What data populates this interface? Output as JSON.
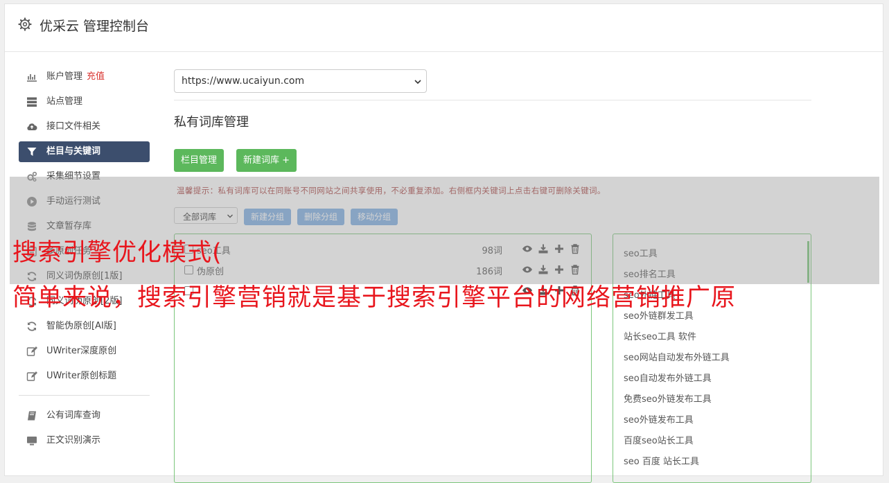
{
  "header": {
    "title": "优采云 管理控制台",
    "icon": "gear-icon"
  },
  "sidebar": {
    "items": [
      {
        "label": "账户管理",
        "badge": "充值",
        "icon": "bar-chart-icon"
      },
      {
        "label": "站点管理",
        "icon": "server-icon"
      },
      {
        "label": "接口文件相关",
        "icon": "cloud-upload-icon"
      },
      {
        "label": "栏目与关键词",
        "icon": "filter-icon",
        "active": true
      },
      {
        "label": "采集细节设置",
        "icon": "gears-icon"
      },
      {
        "label": "手动运行测试",
        "icon": "play-circle-icon"
      },
      {
        "label": "文章暂存库",
        "icon": "database-icon"
      },
      {
        "label": "多原创任务",
        "icon": "tasks-icon"
      },
      {
        "label": "同义词伪原创[1版]",
        "icon": "refresh-icon"
      },
      {
        "label": "同义词伪原创[2版]",
        "icon": "refresh-icon"
      },
      {
        "label": "智能伪原创[AI版]",
        "icon": "refresh-icon"
      },
      {
        "label": "UWriter深度原创",
        "icon": "edit-icon"
      },
      {
        "label": "UWriter原创标题",
        "icon": "edit-icon"
      }
    ],
    "items2": [
      {
        "label": "公有词库查询",
        "icon": "book-icon"
      },
      {
        "label": "正文识别演示",
        "icon": "monitor-icon"
      }
    ]
  },
  "main": {
    "site_select": "https://www.ucaiyun.com",
    "section_title": "私有词库管理",
    "btn_columns": "栏目管理",
    "btn_new_lib": "新建词库 +",
    "tip": "温馨提示：私有词库可以在同账号不同网站之间共享使用，不必重复添加。右侧框内关键词上点击右键可删除关键词。",
    "lib_filter": "全部词库",
    "btn_new_group": "新建分组",
    "btn_delete_group": "删除分组",
    "btn_move_group": "移动分组",
    "libraries": [
      {
        "name": "seo工具",
        "count": "98词"
      },
      {
        "name": "伪原创",
        "count": "186词"
      },
      {
        "name": "",
        "count": ""
      }
    ],
    "keywords": [
      "seo工具",
      "seo排名工具",
      "seo外链工具",
      "seo外链群发工具",
      "站长seo工具 软件",
      "seo网站自动发布外链工具",
      "seo自动发布外链工具",
      "免费seo外链发布工具",
      "seo外链发布工具",
      "百度seo站长工具",
      "seo 百度 站长工具"
    ]
  },
  "overlay": {
    "line1": "搜索引擎优化模式(",
    "line2": "简单来说，搜索引擎营销就是基于搜索引擎平台的网络营销推广原"
  },
  "colors": {
    "accent_green": "#5cb85c",
    "nav_active": "#3c4e6d",
    "overlay_red": "#e8161d",
    "btn_blue": "#7faee3"
  }
}
